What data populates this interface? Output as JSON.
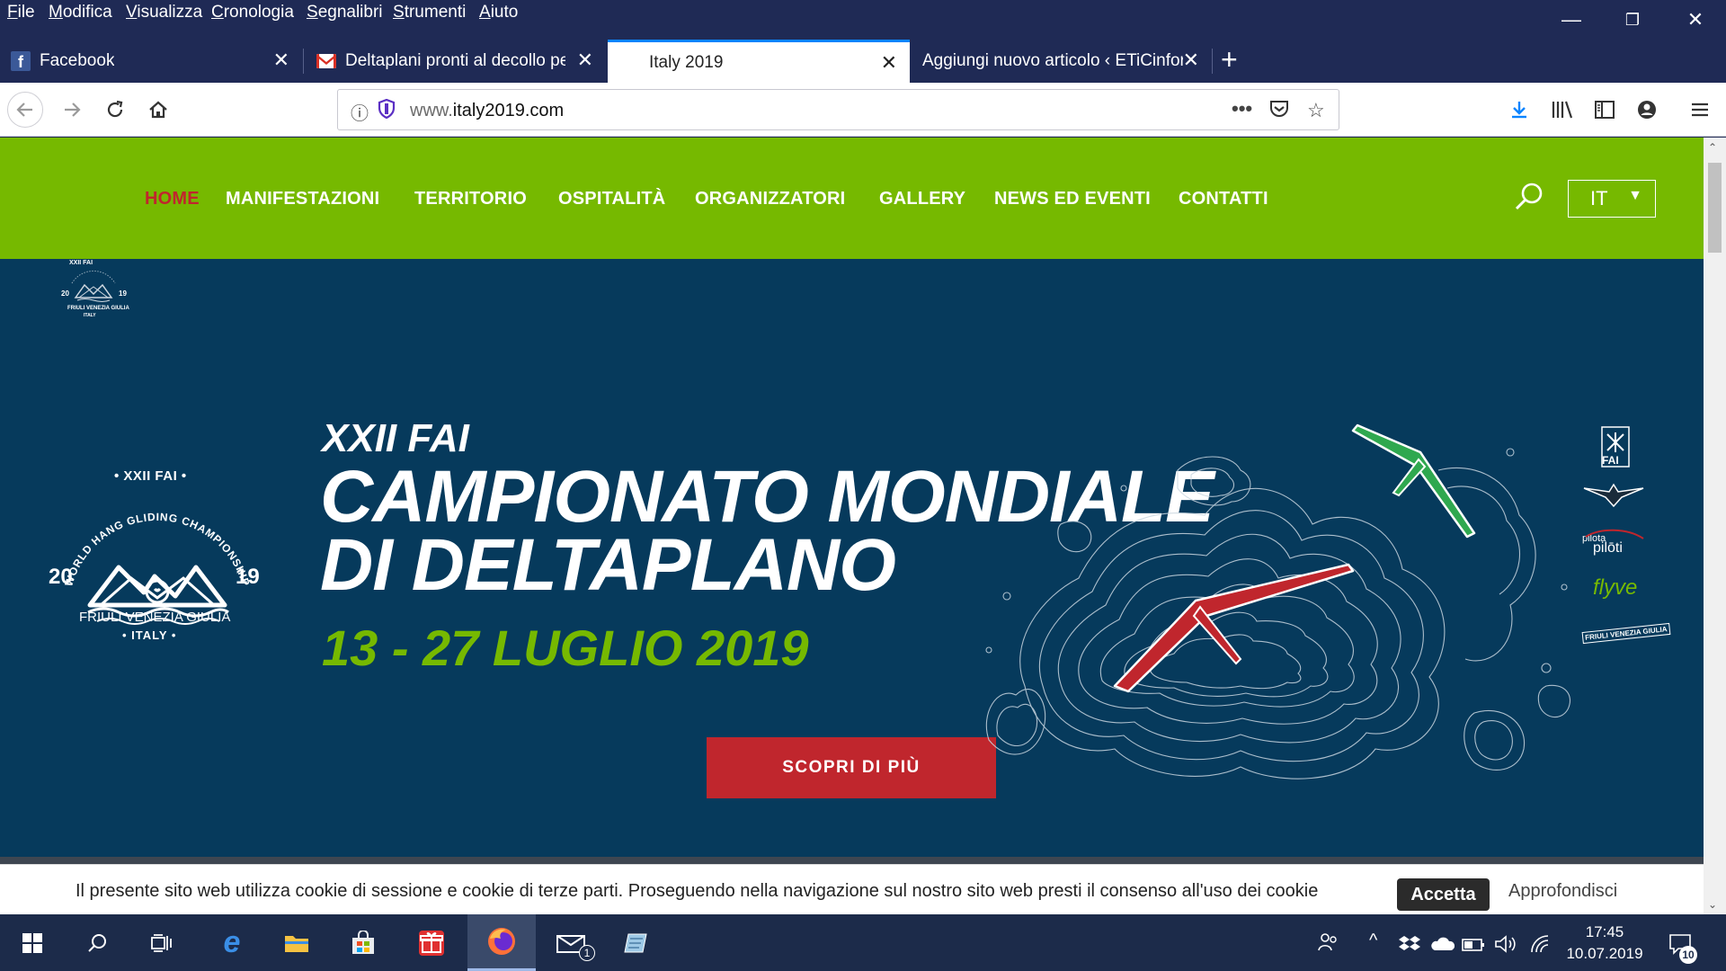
{
  "menubar": {
    "items": [
      "File",
      "Modifica",
      "Visualizza",
      "Cronologia",
      "Segnalibri",
      "Strumenti",
      "Aiuto"
    ],
    "minimize_icon": "minimize-icon",
    "restore_icon": "restore-icon",
    "close_icon": "close-icon"
  },
  "tabs": [
    {
      "title": "Facebook",
      "icon": "facebook-icon",
      "active": false
    },
    {
      "title": "Deltaplani pronti al decollo per",
      "icon": "gmail-icon",
      "active": false
    },
    {
      "title": "Italy 2019",
      "icon": "none",
      "active": true
    },
    {
      "title": "Aggiungi nuovo articolo ‹ ETiCinfor",
      "icon": "none",
      "active": false
    }
  ],
  "navbar": {
    "url_prefix": "www.",
    "url_domain": "italy2019.com",
    "more_icon": "•••"
  },
  "site": {
    "nav": [
      "HOME",
      "MANIFESTAZIONI",
      "TERRITORIO",
      "OSPITALITÀ",
      "ORGANIZZATORI",
      "GALLERY",
      "NEWS ED EVENTI",
      "CONTATTI"
    ],
    "active_nav": "HOME",
    "lang": "IT",
    "small_logo": {
      "line1": "XXII FAI",
      "year_left": "20",
      "year_right": "19",
      "region": "FRIULI VENEZIA GIULIA",
      "country": "ITALY"
    },
    "emblem": {
      "top": "• XXII FAI •",
      "arc": "WORLD HANG GLIDING CHAMPIONSHIP",
      "year_left": "20",
      "year_right": "19",
      "region": "FRIULI VENEZIA GIULIA",
      "country": "• ITALY •"
    },
    "hero": {
      "subtitle": "XXII FAI",
      "title_line1": "CAMPIONATO MONDIALE",
      "title_line2": "DI DELTAPLANO",
      "dates": "13 - 27 LUGLIO 2019",
      "cta": "SCOPRI DI PIÙ"
    },
    "sponsors": [
      "FAI",
      "pilota",
      "pilōti",
      "flyve",
      "FRIULI VENEZIA GIULIA"
    ],
    "colors": {
      "nav_green": "#76b900",
      "hero_blue": "#063a5c",
      "accent_red": "#c0262d",
      "glider_green": "#2fa84f"
    }
  },
  "cookie": {
    "text": "Il presente sito web utilizza cookie di sessione e cookie di terze parti. Proseguendo nella navigazione sul nostro sito web presti il consenso all'uso dei cookie",
    "accept": "Accetta",
    "more": "Approfondisci"
  },
  "taskbar": {
    "time": "17:45",
    "date": "10.07.2019",
    "mail_badge": "1",
    "notif_count": "10"
  }
}
